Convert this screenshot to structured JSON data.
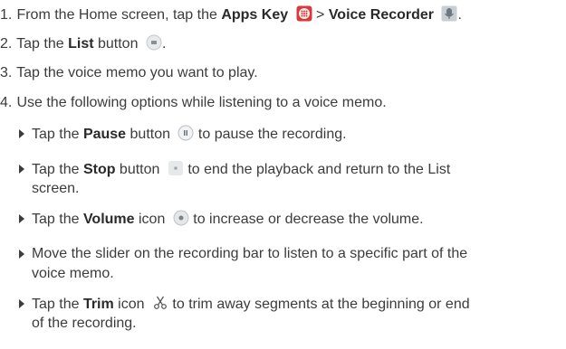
{
  "steps": [
    {
      "num": "1.",
      "pre": "From the Home screen, tap the ",
      "b1": "Apps Key",
      "mid": " > ",
      "b2": "Voice Recorder",
      "post": "."
    },
    {
      "num": "2.",
      "pre": "Tap the ",
      "b1": "List",
      "post": " button",
      "end": "."
    },
    {
      "num": "3.",
      "text": "Tap the voice memo you want to play."
    },
    {
      "num": "4.",
      "text": "Use the following options while listening to a voice memo."
    }
  ],
  "options": [
    {
      "pre": "Tap the ",
      "b": "Pause",
      "post": " button",
      "tail": " to pause the recording."
    },
    {
      "pre": "Tap the ",
      "b": "Stop",
      "post": " button",
      "tail": " to end the playback and return to the List",
      "line2": "screen."
    },
    {
      "pre": "Tap the ",
      "b": "Volume",
      "post": " icon",
      "tail": " to increase or decrease the volume."
    },
    {
      "text": "Move the slider on the recording bar to listen to a specific part of the",
      "line2": "voice memo."
    },
    {
      "pre": "Tap the ",
      "b": "Trim",
      "post": " icon",
      "tail": " to trim away segments at the beginning or end",
      "line2": "of the recording."
    }
  ],
  "icons": {
    "apps": "apps-key-icon",
    "recorder": "voice-recorder-icon",
    "list": "list-button-icon",
    "pause": "pause-button-icon",
    "stop": "stop-button-icon",
    "volume": "volume-icon",
    "trim": "scissors-icon"
  },
  "colors": {
    "apps_red": "#d83a3a",
    "text": "#3c3c3c"
  }
}
